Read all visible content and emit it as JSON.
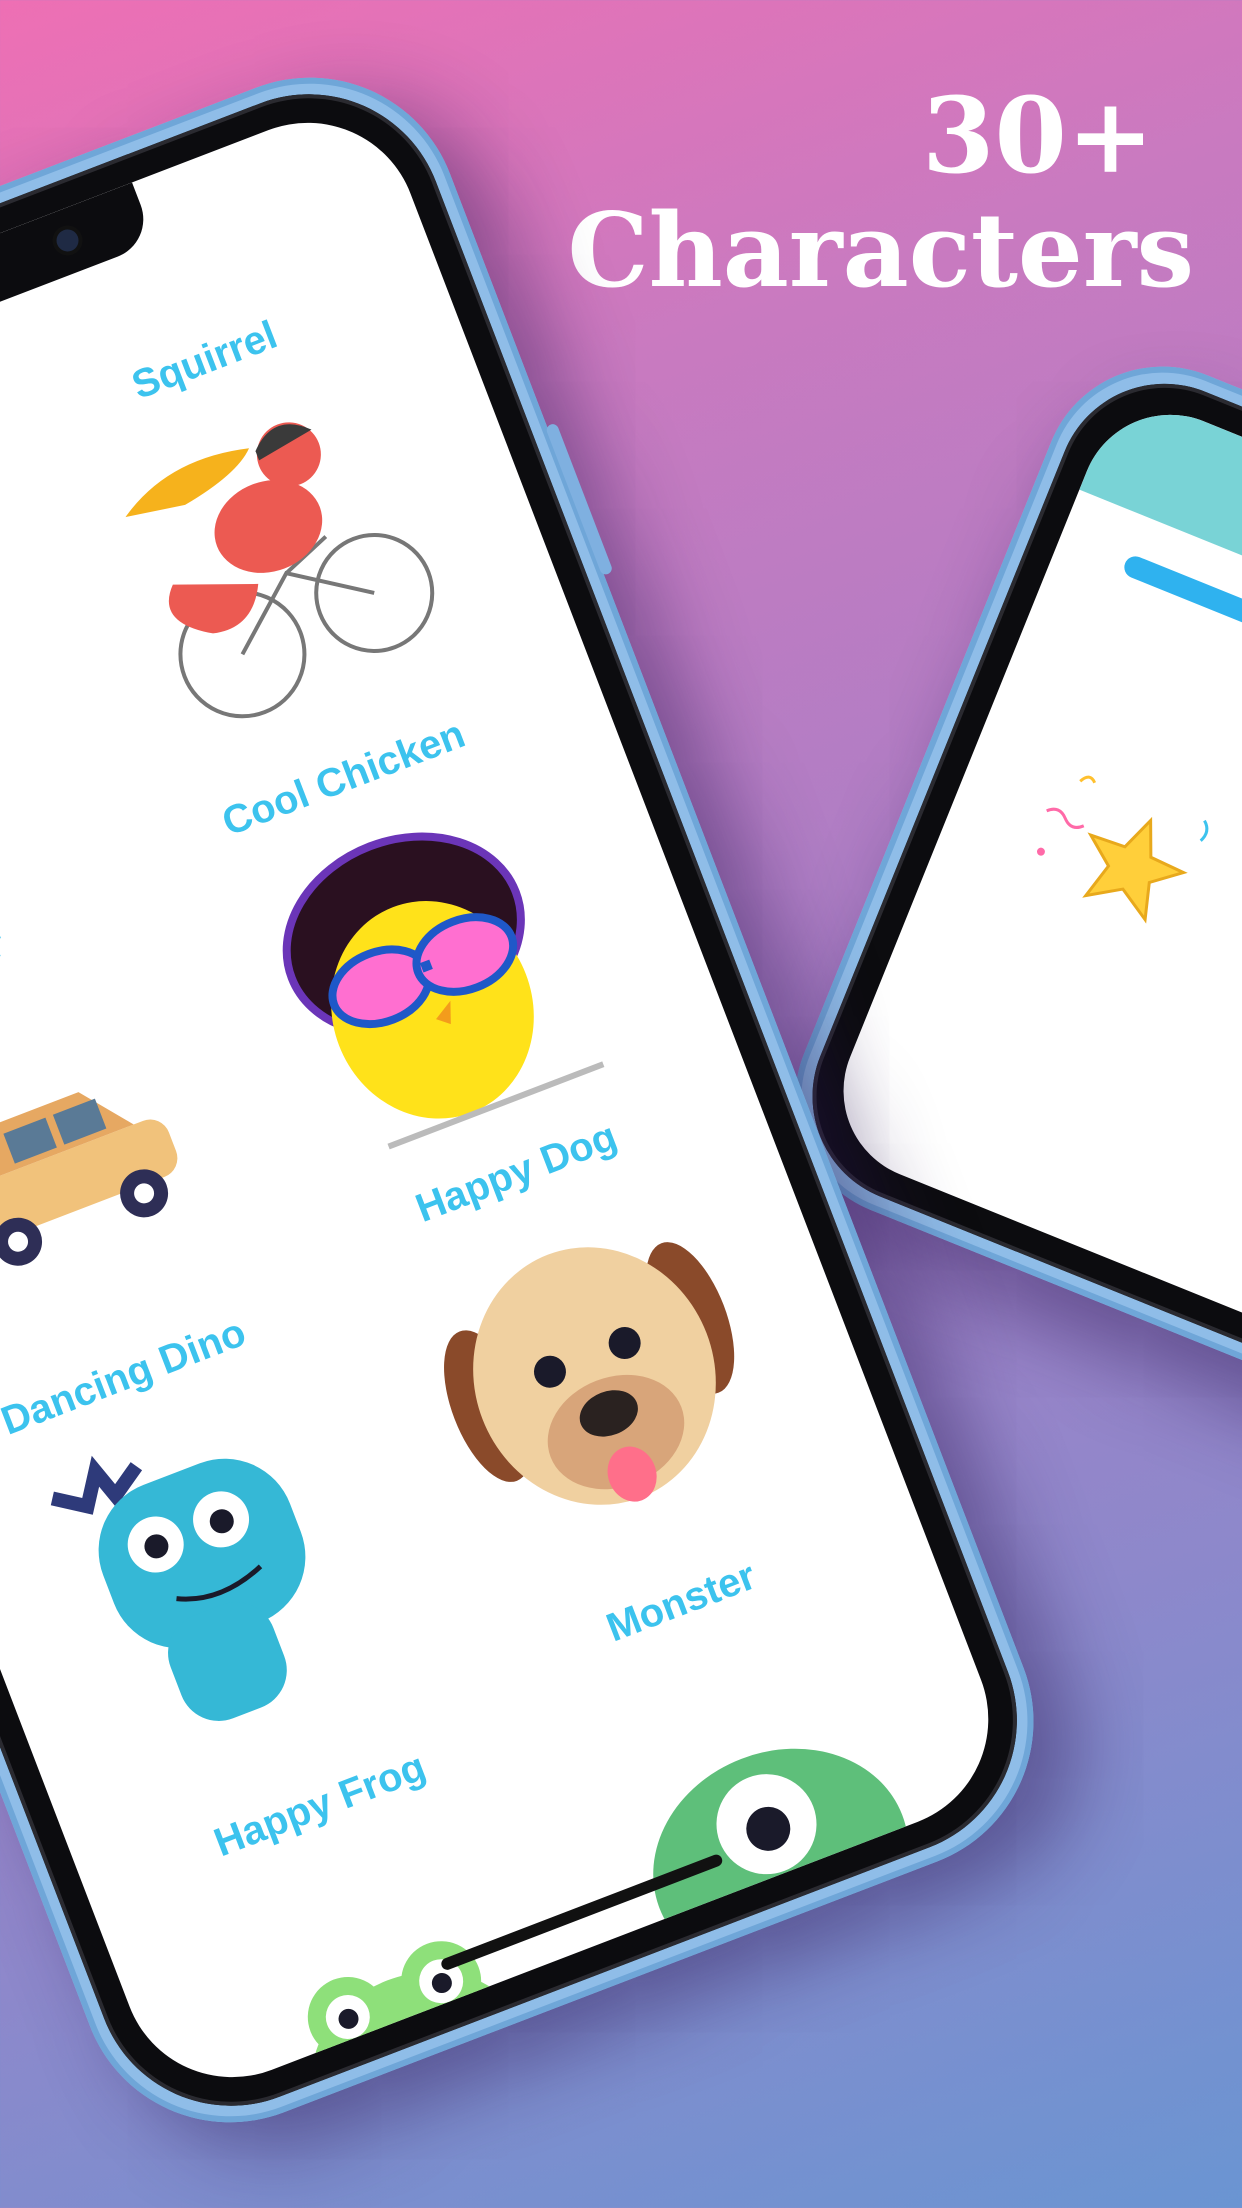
{
  "headline": {
    "line1": "30+",
    "line2": "Characters"
  },
  "characters": [
    {
      "name": "Squirrel"
    },
    {
      "name": "Car"
    },
    {
      "name": "Cool Chicken"
    },
    {
      "name": "Dancing Dino"
    },
    {
      "name": "Happy Dog"
    },
    {
      "name": "Happy Frog"
    },
    {
      "name": "Monster"
    }
  ],
  "colors": {
    "label": "#3cc3ee",
    "frame": "#8fbde8",
    "accent_teal": "#79d3d6",
    "accent_blue": "#2fb2ef"
  }
}
